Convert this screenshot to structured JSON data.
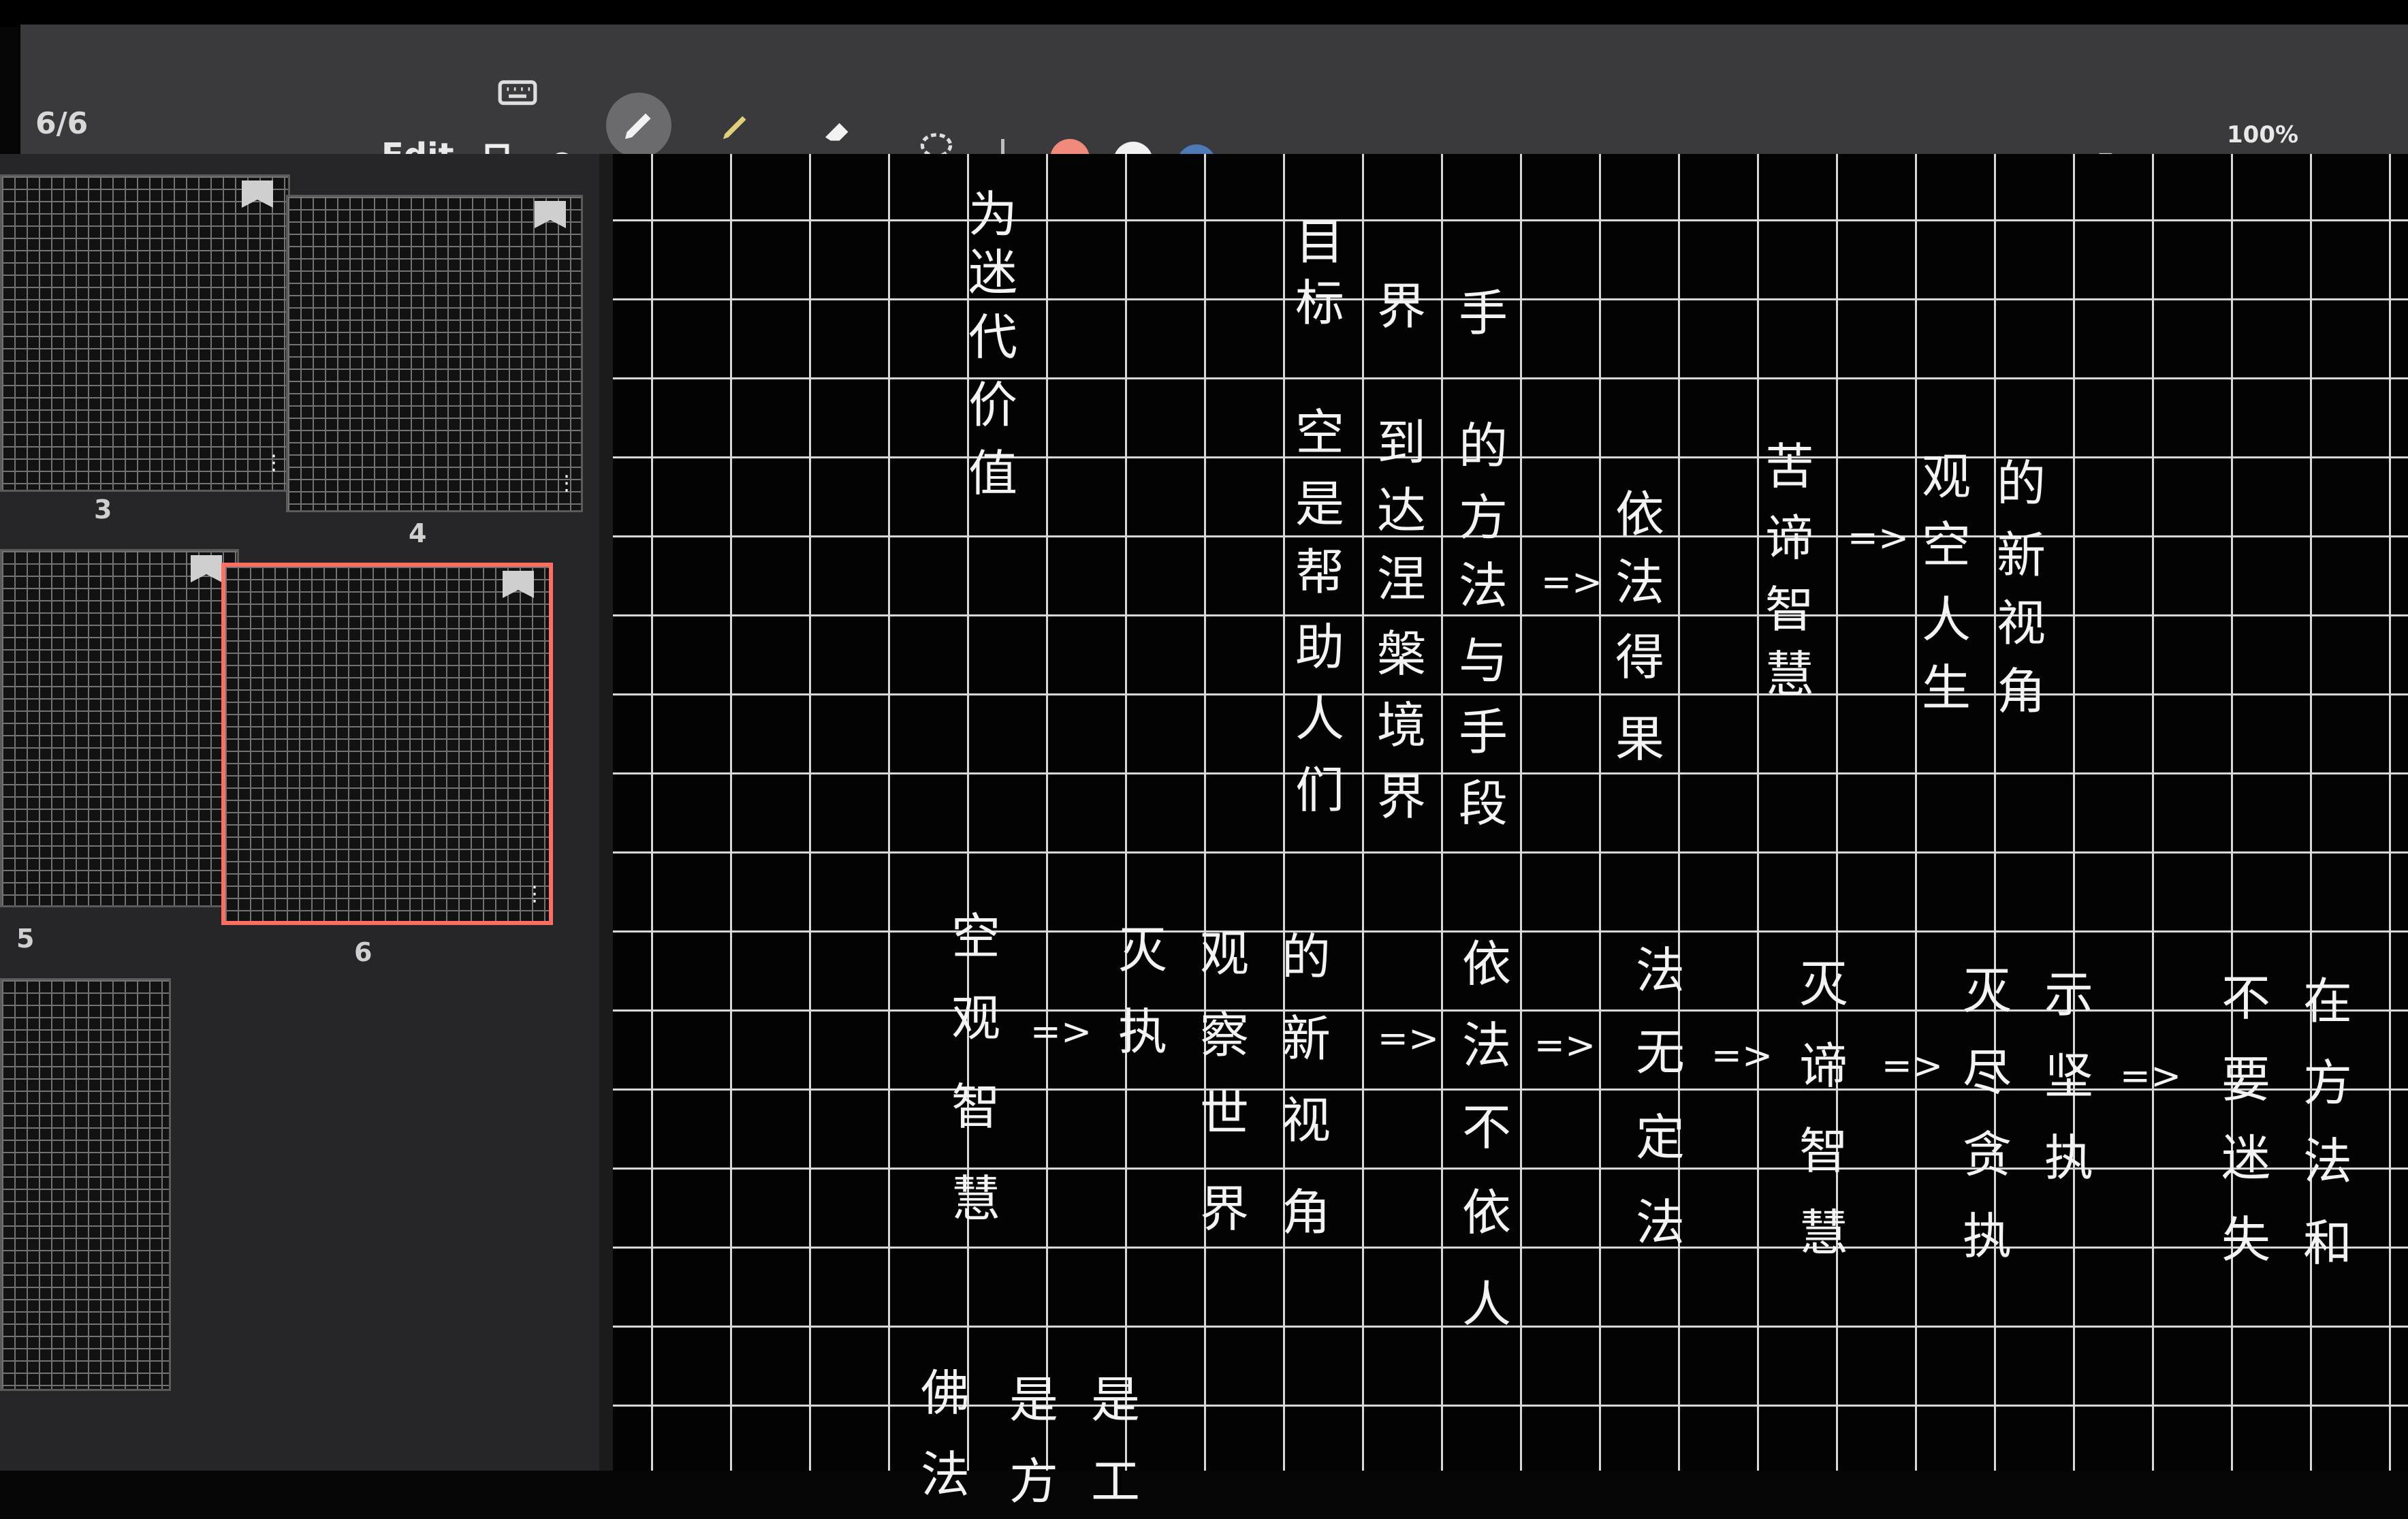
{
  "app": {
    "title_fragment": "",
    "status": "100%"
  },
  "sidebar": {
    "page_counter": "6/6",
    "edit_label": "Edit",
    "thumbnails": [
      {
        "label": "3"
      },
      {
        "label": "4"
      },
      {
        "label": "5"
      },
      {
        "label": "6",
        "selected": true
      }
    ]
  },
  "toolbar": {
    "colors": [
      "#f08a7a",
      "#f1f1f1",
      "#4d79b4"
    ],
    "icons": [
      "keyboard-icon",
      "pen-icon",
      "highlighter-icon",
      "eraser-icon",
      "lasso-icon",
      "undo-icon",
      "redo-icon",
      "shape-icon",
      "text-icon",
      "image-icon",
      "expand-icon",
      "pages-icon",
      "more-icon"
    ]
  },
  "canvas": {
    "chars": [
      {
        "t": "为"
      },
      {
        "t": "迷"
      },
      {
        "t": "代"
      },
      {
        "t": "价"
      },
      {
        "t": "值"
      },
      {
        "t": "目"
      },
      {
        "t": "标"
      },
      {
        "t": "界"
      },
      {
        "t": "手"
      },
      {
        "t": "空"
      },
      {
        "t": "到"
      },
      {
        "t": "的"
      },
      {
        "t": "是"
      },
      {
        "t": "达"
      },
      {
        "t": "方"
      },
      {
        "t": "帮"
      },
      {
        "t": "涅"
      },
      {
        "t": "法"
      },
      {
        "t": "助"
      },
      {
        "t": "槃"
      },
      {
        "t": "与"
      },
      {
        "t": "人"
      },
      {
        "t": "境"
      },
      {
        "t": "手"
      },
      {
        "t": "们"
      },
      {
        "t": "界"
      },
      {
        "t": "段"
      },
      {
        "t": "依"
      },
      {
        "t": "法"
      },
      {
        "t": "得"
      },
      {
        "t": "果"
      },
      {
        "t": "苦"
      },
      {
        "t": "谛"
      },
      {
        "t": "智"
      },
      {
        "t": "慧"
      },
      {
        "t": "观"
      },
      {
        "t": "的"
      },
      {
        "t": "空"
      },
      {
        "t": "新"
      },
      {
        "t": "人"
      },
      {
        "t": "视"
      },
      {
        "t": "生"
      },
      {
        "t": "角"
      },
      {
        "t": "空"
      },
      {
        "t": "观"
      },
      {
        "t": "智"
      },
      {
        "t": "慧"
      },
      {
        "t": "灭"
      },
      {
        "t": "执"
      },
      {
        "t": "观"
      },
      {
        "t": "察"
      },
      {
        "t": "世"
      },
      {
        "t": "界"
      },
      {
        "t": "的"
      },
      {
        "t": "新"
      },
      {
        "t": "视"
      },
      {
        "t": "角"
      },
      {
        "t": "依"
      },
      {
        "t": "法"
      },
      {
        "t": "不"
      },
      {
        "t": "依"
      },
      {
        "t": "人"
      },
      {
        "t": "法"
      },
      {
        "t": "无"
      },
      {
        "t": "定"
      },
      {
        "t": "法"
      },
      {
        "t": "灭"
      },
      {
        "t": "谛"
      },
      {
        "t": "智"
      },
      {
        "t": "慧"
      },
      {
        "t": "灭"
      },
      {
        "t": "尽"
      },
      {
        "t": "贪"
      },
      {
        "t": "执"
      },
      {
        "t": "示"
      },
      {
        "t": "坚"
      },
      {
        "t": "执"
      },
      {
        "t": "不"
      },
      {
        "t": "要"
      },
      {
        "t": "迷"
      },
      {
        "t": "失"
      },
      {
        "t": "在"
      },
      {
        "t": "方"
      },
      {
        "t": "法"
      },
      {
        "t": "和"
      },
      {
        "t": "佛"
      },
      {
        "t": "法"
      },
      {
        "t": "是"
      },
      {
        "t": "方"
      },
      {
        "t": "是"
      },
      {
        "t": "工"
      }
    ],
    "arrows": [
      "=>",
      "=>",
      "=>",
      "=>",
      "=>",
      "=>",
      "=>",
      "=>"
    ]
  }
}
